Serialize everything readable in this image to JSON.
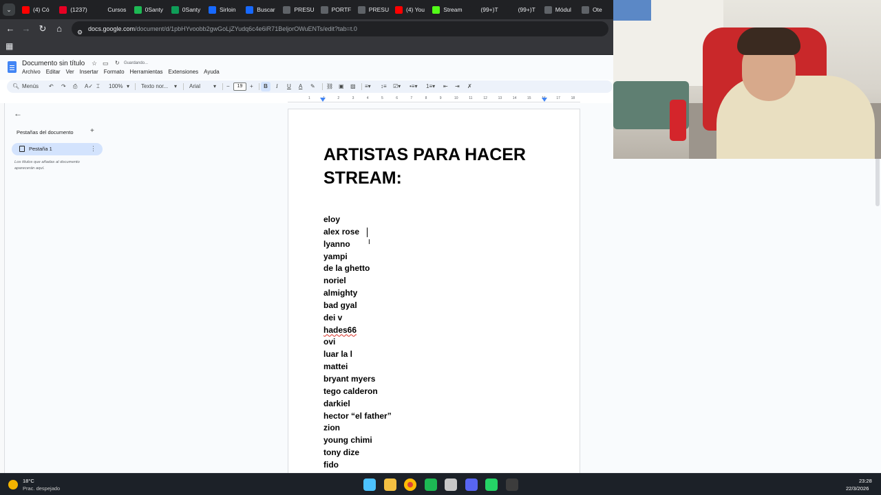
{
  "browser": {
    "tabs": [
      {
        "label": "(4) Có",
        "icon": "youtube-icon",
        "color": "#ff0000"
      },
      {
        "label": "(1237)",
        "icon": "pinterest-icon",
        "color": "#e60023"
      },
      {
        "label": "Cursos",
        "icon": "blank-icon",
        "color": "#202124"
      },
      {
        "label": "0Santy",
        "icon": "spotify-icon",
        "color": "#1db954"
      },
      {
        "label": "0Santy",
        "icon": "sheets-icon",
        "color": "#0f9d58"
      },
      {
        "label": "Sirloin",
        "icon": "behance-icon",
        "color": "#1769ff"
      },
      {
        "label": "Buscar",
        "icon": "behance-icon",
        "color": "#1769ff"
      },
      {
        "label": "PRESU",
        "icon": "globe-icon",
        "color": "#5f6368"
      },
      {
        "label": "PORTF",
        "icon": "globe-icon",
        "color": "#5f6368"
      },
      {
        "label": "PRESU",
        "icon": "globe-icon",
        "color": "#5f6368"
      },
      {
        "label": "(4) You",
        "icon": "youtube-icon",
        "color": "#ff0000"
      },
      {
        "label": "Stream",
        "icon": "kick-icon",
        "color": "#53fc18"
      },
      {
        "label": "(99+)T",
        "icon": "tiktok-icon",
        "color": "#202124"
      },
      {
        "label": "(99+)T",
        "icon": "tiktok-icon",
        "color": "#202124"
      },
      {
        "label": "Módul",
        "icon": "globe-icon",
        "color": "#5f6368"
      },
      {
        "label": "Ote",
        "icon": "globe-icon",
        "color": "#5f6368"
      }
    ],
    "url_domain": "docs.google.com",
    "url_path": "/document/d/1pbHYvoobb2gwGoLjZYudq6c4e6iR71BeljorOWuENTs/edit?tab=t.0"
  },
  "docs": {
    "title": "Documento sin título",
    "saving_status": "Guardando...",
    "menu": [
      "Archivo",
      "Editar",
      "Ver",
      "Insertar",
      "Formato",
      "Herramientas",
      "Extensiones",
      "Ayuda"
    ],
    "toolbar": {
      "menus_label": "Menús",
      "zoom": "100%",
      "style": "Texto nor...",
      "font": "Arial",
      "font_size": "19"
    },
    "ruler_marks": [
      "1",
      "1",
      "2",
      "3",
      "4",
      "5",
      "6",
      "7",
      "8",
      "9",
      "10",
      "11",
      "12",
      "13",
      "14",
      "15",
      "16",
      "17",
      "18"
    ]
  },
  "outline_panel": {
    "heading": "Pestañas del documento",
    "tab_label": "Pestaña 1",
    "hint": "Los títulos que añadas al documento aparecerán aquí."
  },
  "document": {
    "heading": "ARTISTAS PARA HACER STREAM:",
    "artists": [
      "eloy",
      "alex rose",
      "lyanno",
      "yampi",
      "de la ghetto",
      "noriel",
      "almighty",
      "bad gyal",
      "dei v",
      "hades66",
      "ovi",
      "luar la l",
      "mattei",
      "bryant myers",
      "tego calderon",
      "darkiel",
      "hector “el father”",
      "zion",
      "young chimi",
      "tony dize",
      "fido"
    ]
  },
  "taskbar": {
    "weather_temp": "18°C",
    "weather_desc": "Prac. despejado",
    "time": "23:28",
    "date": "22/3/2026",
    "apps": [
      {
        "name": "windows-start-icon",
        "color": "#4cc2ff"
      },
      {
        "name": "file-explorer-icon",
        "color": "#f4c042"
      },
      {
        "name": "chrome-icon",
        "color": "#db4437"
      },
      {
        "name": "spotify-icon",
        "color": "#1db954"
      },
      {
        "name": "settings-icon",
        "color": "#c8c8c8"
      },
      {
        "name": "discord-icon",
        "color": "#5865f2"
      },
      {
        "name": "whatsapp-icon",
        "color": "#25d366"
      },
      {
        "name": "obs-icon",
        "color": "#3c3c3c"
      }
    ]
  }
}
